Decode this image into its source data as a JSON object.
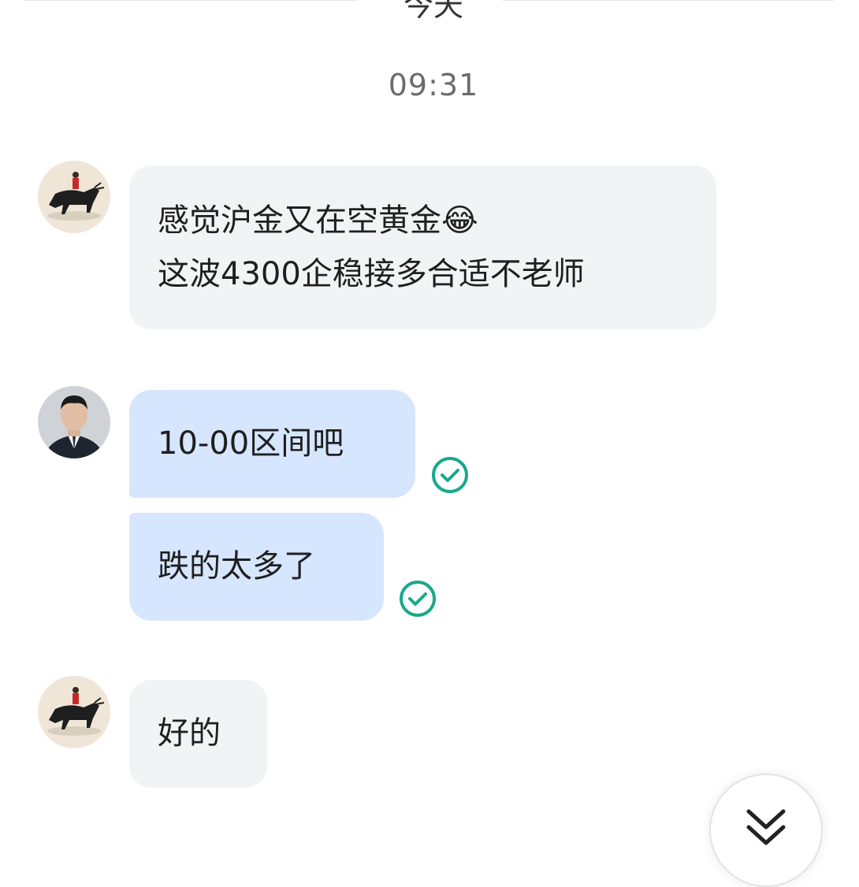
{
  "chat": {
    "date_divider": "今天",
    "timestamp": "09:31",
    "messages": [
      {
        "sender": "customer",
        "lines": [
          "感觉沪金又在空黄金😂",
          "这波4300企稳接多合适不老师"
        ]
      },
      {
        "sender": "advisor",
        "lines": [
          "10-00区间吧"
        ],
        "status": "read"
      },
      {
        "sender": "advisor",
        "lines": [
          "跌的太多了"
        ],
        "status": "read"
      },
      {
        "sender": "customer",
        "lines": [
          "好的"
        ]
      }
    ]
  },
  "icons": {
    "read_status": "check-circle-icon",
    "scroll_down": "double-chevron-down-icon"
  },
  "colors": {
    "incoming_bubble": "#f2f3f5",
    "outgoing_bubble": "#d6e6fe",
    "read_check": "#19a88a"
  }
}
